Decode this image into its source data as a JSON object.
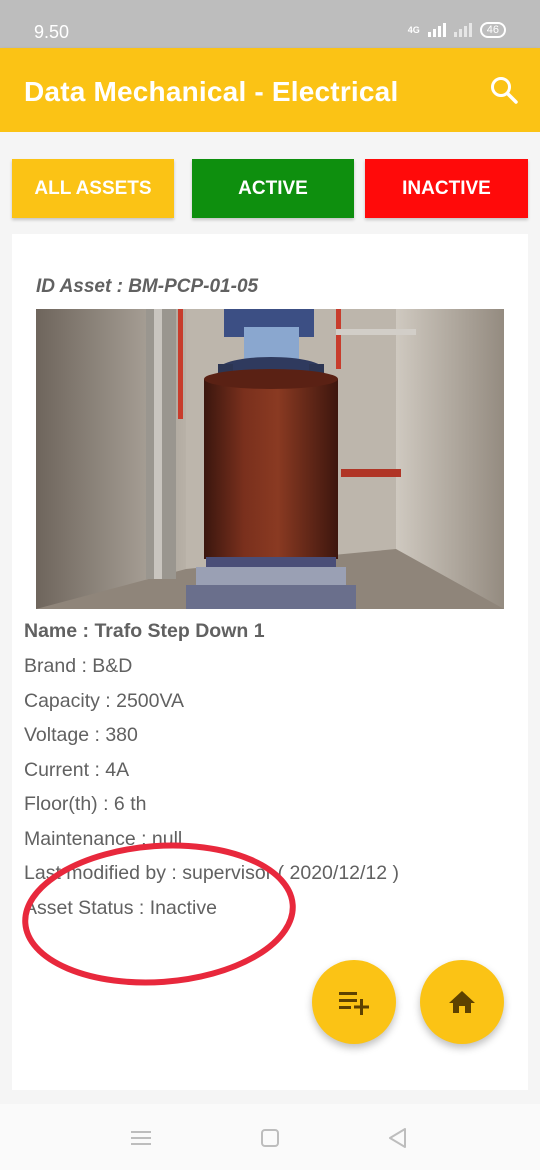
{
  "status_bar": {
    "time": "9.50",
    "network_label": "4G",
    "battery": "46"
  },
  "app_bar": {
    "title": "Data Mechanical - Electrical",
    "search_icon": "search-icon"
  },
  "filters": [
    {
      "label": "ALL ASSETS",
      "color": "#fbc315"
    },
    {
      "label": "ACTIVE",
      "color": "#0e8f0e"
    },
    {
      "label": "INACTIVE",
      "color": "#ff0a0a"
    }
  ],
  "asset": {
    "id_line": "ID Asset : BM-PCP-01-05",
    "name_line": "Name : Trafo Step Down 1",
    "brand_line": "Brand : B&D",
    "capacity_line": "Capacity : 2500VA",
    "voltage_line": "Voltage : 380",
    "current_line": "Current : 4A",
    "floor_line": "Floor(th) : 6 th",
    "maintenance_line": "Maintenance : null",
    "modified_line": "Last modified by : supervisor ( 2020/12/12 )",
    "status_line": "Asset Status : Inactive"
  },
  "fabs": {
    "add_icon": "playlist-add-icon",
    "home_icon": "home-icon"
  },
  "nav": {
    "menu_icon": "menu-icon",
    "home_icon": "square-home-icon",
    "back_icon": "back-triangle-icon"
  },
  "colors": {
    "accent": "#fbc315",
    "active": "#0e8f0e",
    "inactive": "#ff0a0a",
    "annotation": "#e8283c"
  }
}
